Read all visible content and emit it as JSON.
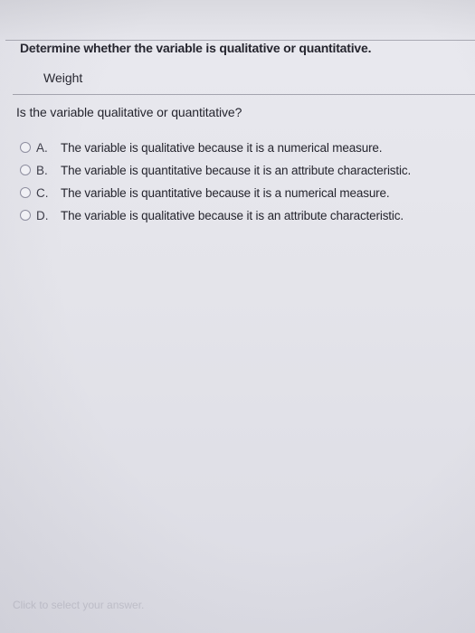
{
  "question": {
    "instruction": "Determine whether the variable is qualitative or quantitative.",
    "variable": "Weight",
    "prompt": "Is the variable qualitative or quantitative?"
  },
  "options": [
    {
      "letter": "A.",
      "text": "The variable is qualitative because it is a numerical measure."
    },
    {
      "letter": "B.",
      "text": "The variable is quantitative because it is an attribute characteristic."
    },
    {
      "letter": "C.",
      "text": "The variable is quantitative because it is a numerical measure."
    },
    {
      "letter": "D.",
      "text": "The variable is qualitative because it is an attribute characteristic."
    }
  ],
  "status": {
    "hint": "Click to select your answer."
  }
}
